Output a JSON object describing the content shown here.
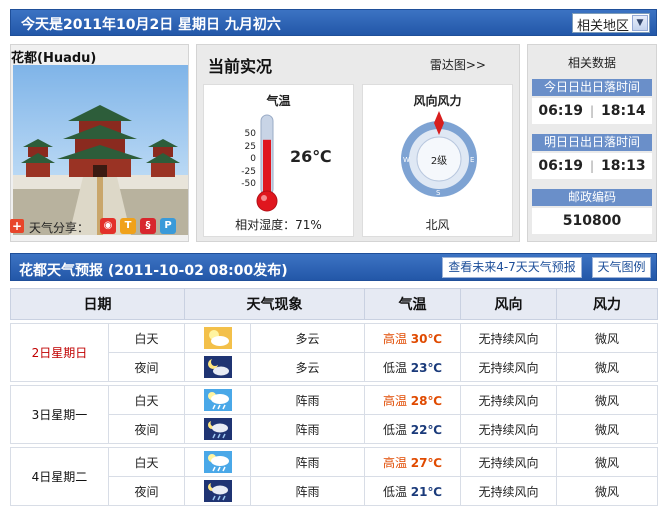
{
  "header": {
    "date_text": "今天是2011年10月2日  星期日  九月初六",
    "region_select": "相关地区"
  },
  "city": {
    "name": "花都(Huadu)",
    "share_label": "天气分享："
  },
  "current": {
    "title": "当前实况",
    "radar_link": "雷达图>>",
    "temp_title": "气温",
    "scale": [
      "50",
      "25",
      "0",
      "-25",
      "-50"
    ],
    "temperature": "26℃",
    "humidity": "相对湿度：71%",
    "temp_level_c": 26,
    "wind_title": "风向风力",
    "wind_level": "2级",
    "wind_direction": "北风",
    "compass": {
      "n": "N",
      "s": "S",
      "e": "E",
      "w": "W"
    }
  },
  "related": {
    "title": "相关数据",
    "today_label": "今日日出日落时间",
    "today_sunrise": "06:19",
    "today_sunset": "18:14",
    "tomorrow_label": "明日日出日落时间",
    "tomorrow_sunrise": "06:19",
    "tomorrow_sunset": "18:13",
    "postcode_label": "邮政编码",
    "postcode": "510800"
  },
  "forecast": {
    "title": "花都天气预报  (2011-10-02  08:00发布)",
    "btn_47": "查看未来4-7天天气预报",
    "btn_legend": "天气图例",
    "headers": {
      "date": "日期",
      "phenom": "天气现象",
      "temp": "气温",
      "wind_dir": "风向",
      "wind_force": "风力"
    },
    "days": [
      {
        "date": "2日星期日",
        "day": {
          "period": "白天",
          "icon": "partly-cloudy-sun-icon",
          "weather": "多云",
          "temp_label": "高温",
          "temp": "30℃",
          "dir": "无持续风向",
          "force": "微风"
        },
        "night": {
          "period": "夜间",
          "icon": "partly-cloudy-moon-icon",
          "weather": "多云",
          "temp_label": "低温",
          "temp": "23℃",
          "dir": "无持续风向",
          "force": "微风"
        }
      },
      {
        "date": "3日星期一",
        "day": {
          "period": "白天",
          "icon": "shower-sun-icon",
          "weather": "阵雨",
          "temp_label": "高温",
          "temp": "28℃",
          "dir": "无持续风向",
          "force": "微风"
        },
        "night": {
          "period": "夜间",
          "icon": "shower-moon-icon",
          "weather": "阵雨",
          "temp_label": "低温",
          "temp": "22℃",
          "dir": "无持续风向",
          "force": "微风"
        }
      },
      {
        "date": "4日星期二",
        "day": {
          "period": "白天",
          "icon": "shower-sun-icon",
          "weather": "阵雨",
          "temp_label": "高温",
          "temp": "27℃",
          "dir": "无持续风向",
          "force": "微风"
        },
        "night": {
          "period": "夜间",
          "icon": "shower-moon-icon",
          "weather": "阵雨",
          "temp_label": "低温",
          "temp": "21℃",
          "dir": "无持续风向",
          "force": "微风"
        }
      }
    ]
  },
  "colors": {
    "header_blue": "#2357a8",
    "high_temp": "#e04a00",
    "low_temp": "#1a3a7a",
    "today_red": "#c00000"
  }
}
